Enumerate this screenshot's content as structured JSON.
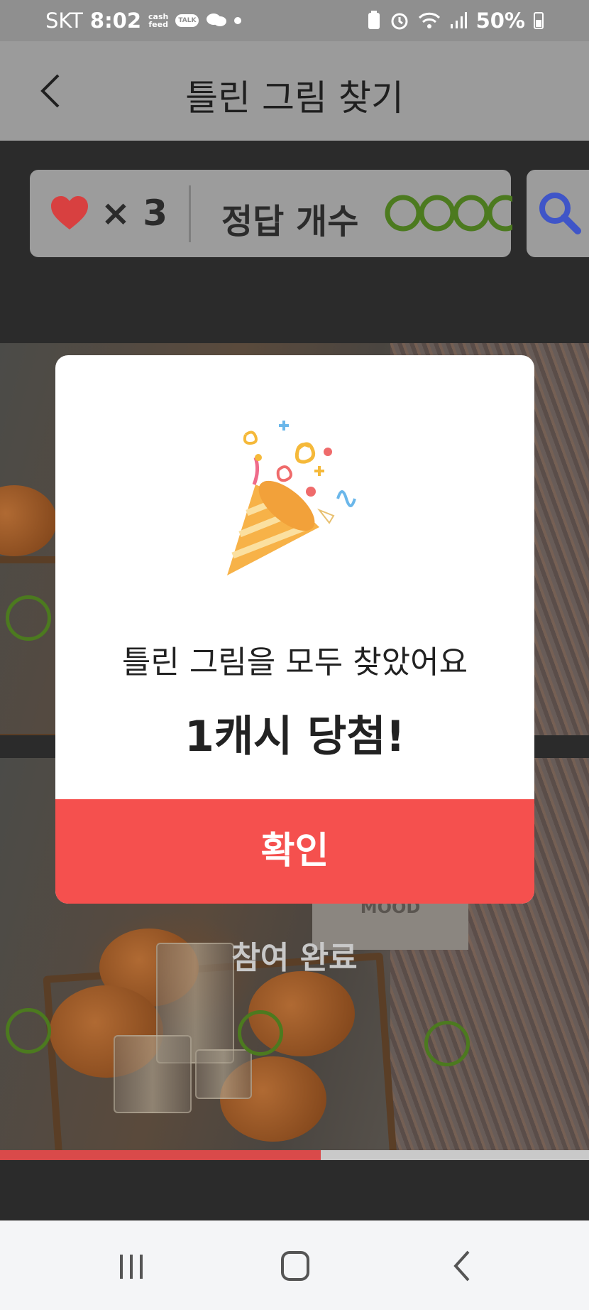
{
  "status_bar": {
    "carrier": "SKT",
    "time": "8:02",
    "app_badge_top": "cash",
    "app_badge_bottom": "feed",
    "talk_badge": "TALK",
    "battery_text": "50%"
  },
  "header": {
    "title": "틀린 그림 찾기"
  },
  "stats": {
    "lives_text": "× 3",
    "answers_label": "정답 개수",
    "found_count": 4
  },
  "photo": {
    "sign_text": "MOOD",
    "done_text": "참여 완료"
  },
  "progress": {
    "fraction": 0.545
  },
  "modal": {
    "message": "틀린 그림을 모두 찾았어요",
    "prize": "1캐시 당첨!",
    "confirm_label": "확인"
  },
  "colors": {
    "accent": "#f5504e",
    "ring_green": "#4c7a1f",
    "heart_red": "#d84040",
    "hint_blue": "#3f55c8"
  },
  "icons": {
    "back": "chevron-left-icon",
    "heart": "heart-icon",
    "search": "search-icon",
    "popper": "party-popper-icon",
    "nav_recents": "recent-apps-icon",
    "nav_home": "home-icon",
    "nav_back": "back-icon"
  }
}
